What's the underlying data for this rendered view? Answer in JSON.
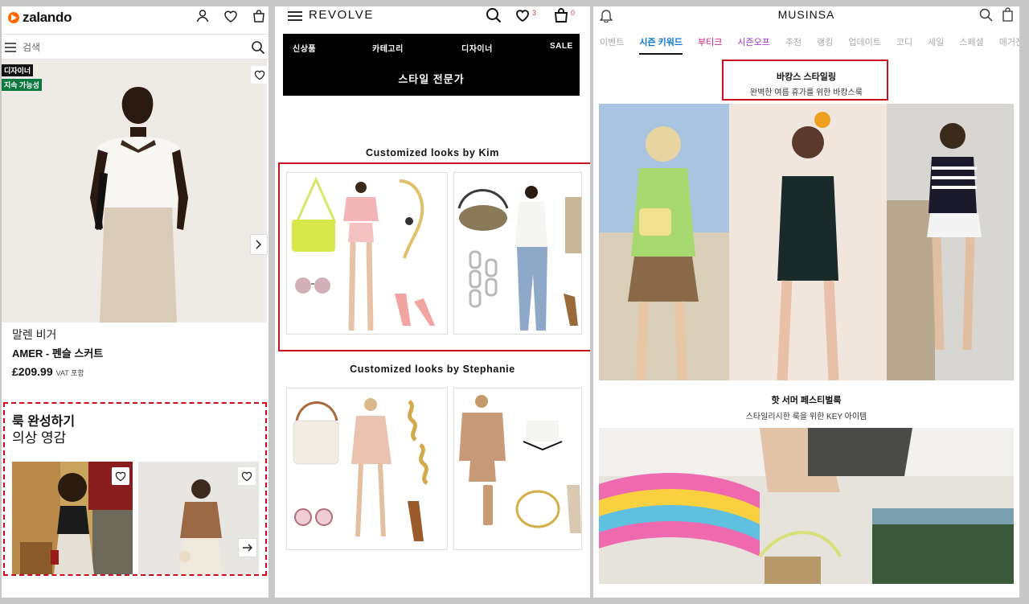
{
  "zalando": {
    "logo": "zalando",
    "search_placeholder": "검색",
    "badges": [
      "디자이너",
      "지속 가능성"
    ],
    "product": {
      "brand": "말렌 비거",
      "name": "AMER - 펜슬 스커트",
      "price": "£209.99",
      "vat": "VAT 포함"
    },
    "complete_look": {
      "title": "룩 완성하기",
      "subtitle": "의상 영감"
    },
    "colors": {
      "brand": "#ff6900",
      "badge_designer": "#111111",
      "badge_sustain": "#0b7a3e",
      "highlight": "#d0021b"
    }
  },
  "revolve": {
    "logo": "REVOLVE",
    "wishlist_count": "3",
    "cart_count": "0",
    "nav": [
      "신상품",
      "카테고리",
      "디자이너",
      "SALE"
    ],
    "expert_label": "스타일 전문가",
    "sections": [
      {
        "title": "Customized looks by Kim"
      },
      {
        "title": "Customized looks by Stephanie"
      }
    ],
    "colors": {
      "highlight": "#c8101e"
    }
  },
  "musinsa": {
    "logo": "MUSINSA",
    "tabs": [
      "이벤트",
      "시즌 키워드",
      "부티크",
      "시즌오프",
      "추천",
      "랭킹",
      "업데이트",
      "코디",
      "세일",
      "스페셜",
      "매거진"
    ],
    "active_tab": "시즌 키워드",
    "feature1": {
      "title": "바캉스 스타일링",
      "subtitle": "완벽한 여름 휴가를 위한 바캉스룩"
    },
    "feature2": {
      "title": "핫 서머 페스티벌룩",
      "subtitle": "스타일리시한 룩을 위한 KEY 아이템"
    },
    "colors": {
      "active_tab": "#0a76d8",
      "highlight": "#c8101e"
    }
  }
}
